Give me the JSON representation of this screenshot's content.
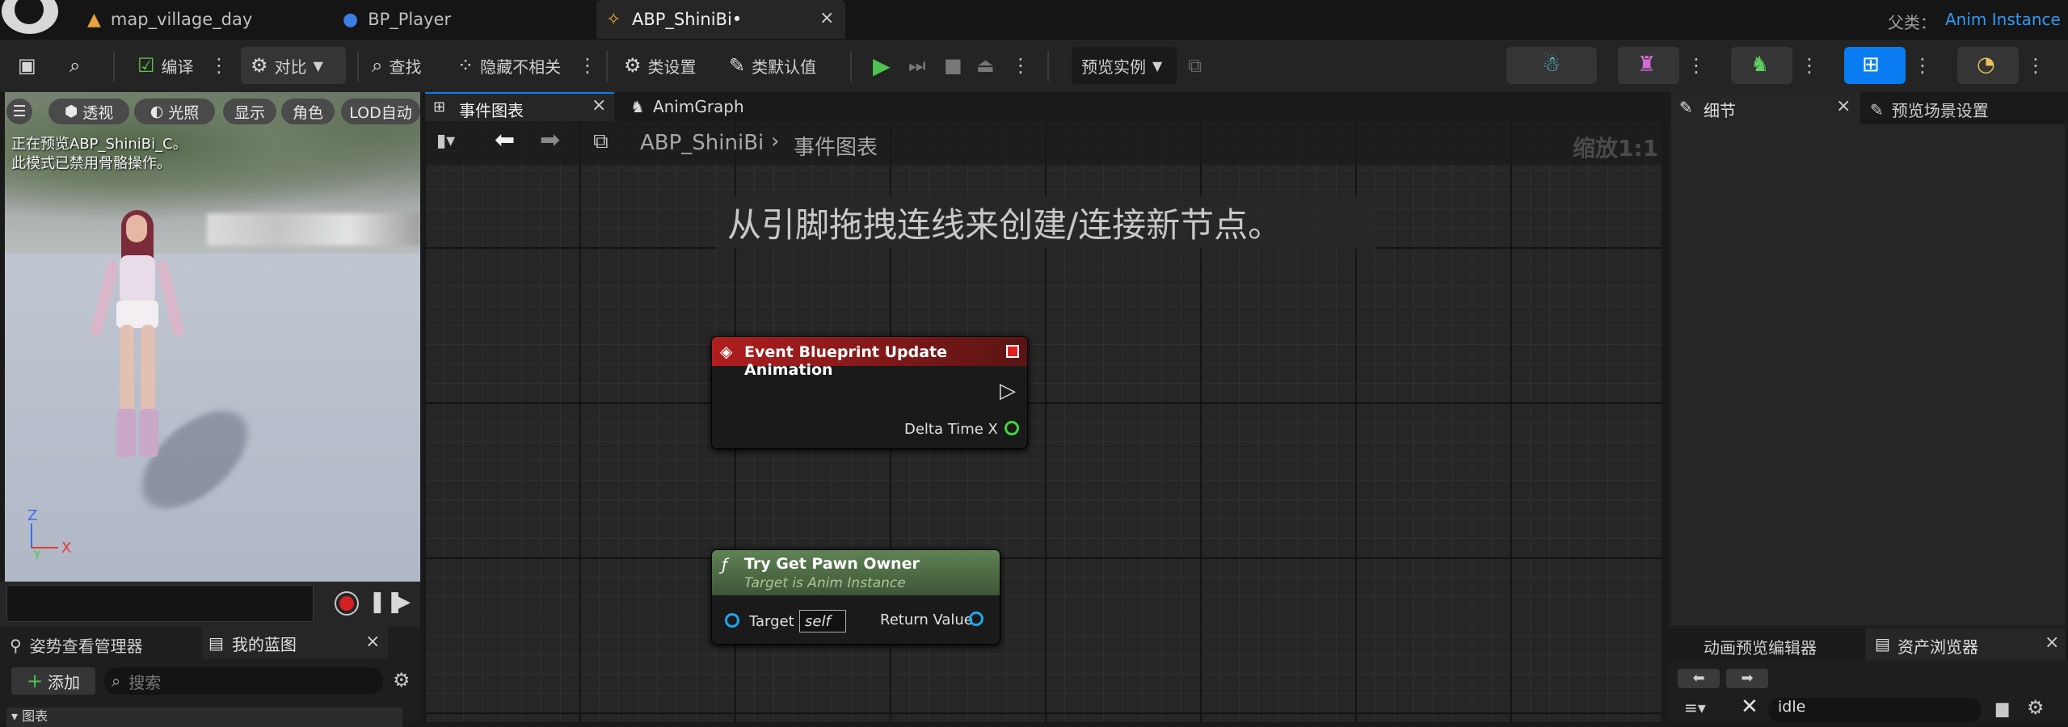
{
  "tabs": [
    {
      "label": "map_village_day",
      "icon": "level-icon"
    },
    {
      "label": "BP_Player",
      "icon": "blueprint-person-icon"
    },
    {
      "label": "ABP_ShiniBi•",
      "icon": "anim-blueprint-icon",
      "active": true
    }
  ],
  "parent_class": {
    "label": "父类：",
    "value": "Anim Instance"
  },
  "toolbar": {
    "compile": "编译",
    "diff": "对比",
    "find": "查找",
    "hide_unrelated": "隐藏不相关",
    "class_settings": "类设置",
    "class_defaults": "类默认值",
    "preview_instance": "预览实例"
  },
  "viewport": {
    "buttons": [
      "透视",
      "光照",
      "显示",
      "角色",
      "LOD自动"
    ],
    "notice_line1": "正在预览ABP_ShiniBi_C。",
    "notice_line2": "此模式已禁用骨骼操作。",
    "axis_z": "Z",
    "axis_x": "X",
    "axis_y": "Y"
  },
  "left_panels": {
    "pose_watch": "姿势查看管理器",
    "my_blueprint": "我的蓝图",
    "add": "添加",
    "search_placeholder": "搜索",
    "graphs": "图表"
  },
  "graph": {
    "tab_event_graph": "事件图表",
    "tab_anim_graph": "AnimGraph",
    "breadcrumb_root": "ABP_ShiniBi",
    "breadcrumb_current": "事件图表",
    "zoom": "缩放1:1",
    "hint": "从引脚拖拽连线来创建/连接新节点。",
    "nodes": {
      "event_title": "Event Blueprint Update Animation",
      "event_pin": "Delta Time X",
      "func_title": "Try Get Pawn Owner",
      "func_subtitle": "Target is Anim Instance",
      "func_target": "Target",
      "func_target_value": "self",
      "func_return": "Return Value"
    }
  },
  "right_panels": {
    "details": "细节",
    "preview_scene": "预览场景设置",
    "anim_preview_editor": "动画预览编辑器",
    "asset_browser": "资产浏览器",
    "asset_search_value": "idle"
  },
  "colors": {
    "accent_blue": "#0a7cf2",
    "event_red": "#8a1a1a",
    "func_green": "#4f6e44",
    "exec_white": "#e0e0e0",
    "float_green": "#3fd63f",
    "object_blue": "#1aa9ee"
  }
}
